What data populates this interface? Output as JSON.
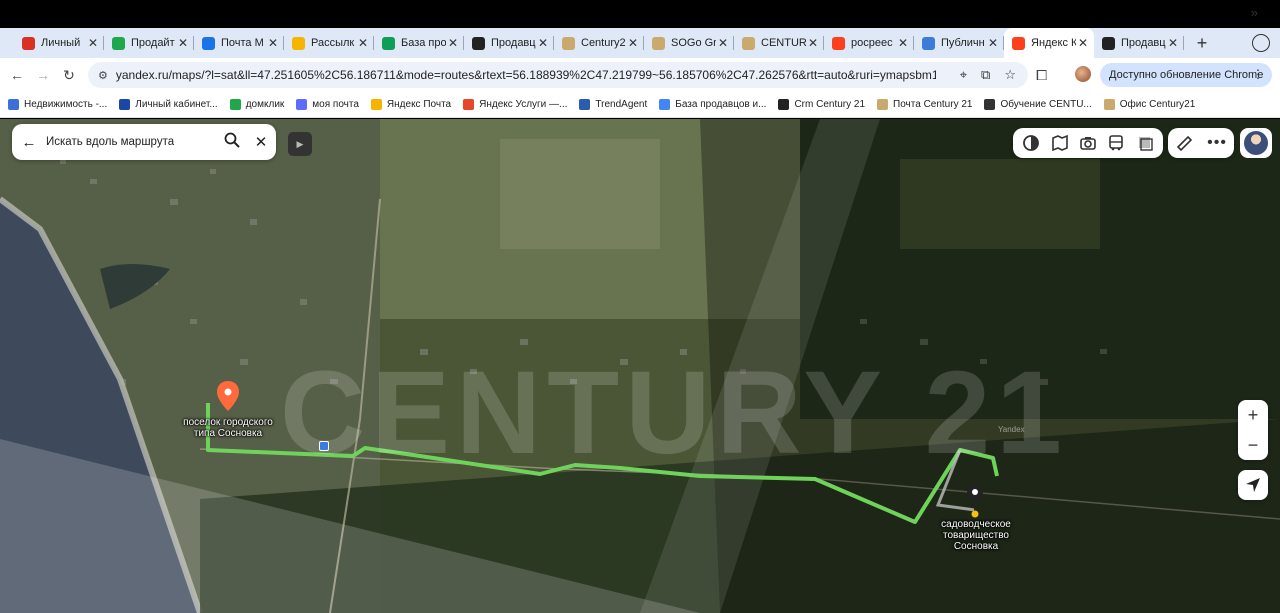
{
  "tabs": [
    {
      "label": "Личный",
      "icon": "notification-icon",
      "color": "#d93025",
      "active": false
    },
    {
      "label": "Продайт",
      "icon": "domclick-icon",
      "color": "#1ea74b",
      "active": false
    },
    {
      "label": "Почта M",
      "icon": "mail-icon",
      "color": "#1a73e8",
      "active": false
    },
    {
      "label": "Рассылк",
      "icon": "yandex-mail-icon",
      "color": "#f5b400",
      "active": false
    },
    {
      "label": "База про",
      "icon": "sheets-icon",
      "color": "#0f9d58",
      "active": false
    },
    {
      "label": "Продавц",
      "icon": "century21-icon",
      "color": "#222222",
      "active": false
    },
    {
      "label": "Century2",
      "icon": "century21-c-icon",
      "color": "#c9a96e",
      "active": false
    },
    {
      "label": "SOGo Gr",
      "icon": "century21-c-icon",
      "color": "#c9a96e",
      "active": false
    },
    {
      "label": "CENTUR",
      "icon": "century21-c-icon",
      "color": "#c9a96e",
      "active": false
    },
    {
      "label": "росреес",
      "icon": "yandex-icon",
      "color": "#fc3f1d",
      "active": false
    },
    {
      "label": "Публичн",
      "icon": "map-book-icon",
      "color": "#3c7bd8",
      "active": false
    },
    {
      "label": "Яндекс К",
      "icon": "yandex-maps-pin-icon",
      "color": "#fc3f1d",
      "active": true
    },
    {
      "label": "Продавц",
      "icon": "century21-icon",
      "color": "#222222",
      "active": false
    }
  ],
  "toolbar": {
    "url": "yandex.ru/maps/?l=sat&ll=47.251605%2C56.186711&mode=routes&rtext=56.188939%2C47.219799~56.185706%2C47.262576&rtt=auto&ruri=ymapsbm1%3A%2F...",
    "update_label": "Доступно обновление Chrome"
  },
  "bookmarks": [
    {
      "label": "Недвижимость -...",
      "color": "#3c6fd8"
    },
    {
      "label": "Личный кабинет...",
      "color": "#1a47a8"
    },
    {
      "label": "домклик",
      "color": "#1ea74b"
    },
    {
      "label": "моя почта",
      "color": "#5b6cff"
    },
    {
      "label": "Яндекс Почта",
      "color": "#f5b400"
    },
    {
      "label": "Яндекс Услуги —...",
      "color": "#e6462a"
    },
    {
      "label": "TrendAgent",
      "color": "#2b5cad"
    },
    {
      "label": "База продавцов и...",
      "color": "#4285f4"
    },
    {
      "label": "Crm Century 21",
      "color": "#222222"
    },
    {
      "label": "Почта Century 21",
      "color": "#c9a96e"
    },
    {
      "label": "Обучение CENTU...",
      "color": "#333333"
    },
    {
      "label": "Офис Century21",
      "color": "#c9a96e"
    }
  ],
  "map": {
    "search_placeholder": "Искать вдоль маршрута",
    "start_label_line1": "поселок городского",
    "start_label_line2": "типа Сосновка",
    "end_label_line1": "садоводческое",
    "end_label_line2": "товарищество",
    "end_label_line3": "Сосновка",
    "watermark": "CENTURY 21",
    "zoom_in": "+",
    "zoom_out": "−",
    "route_color": "#6fd35b"
  }
}
